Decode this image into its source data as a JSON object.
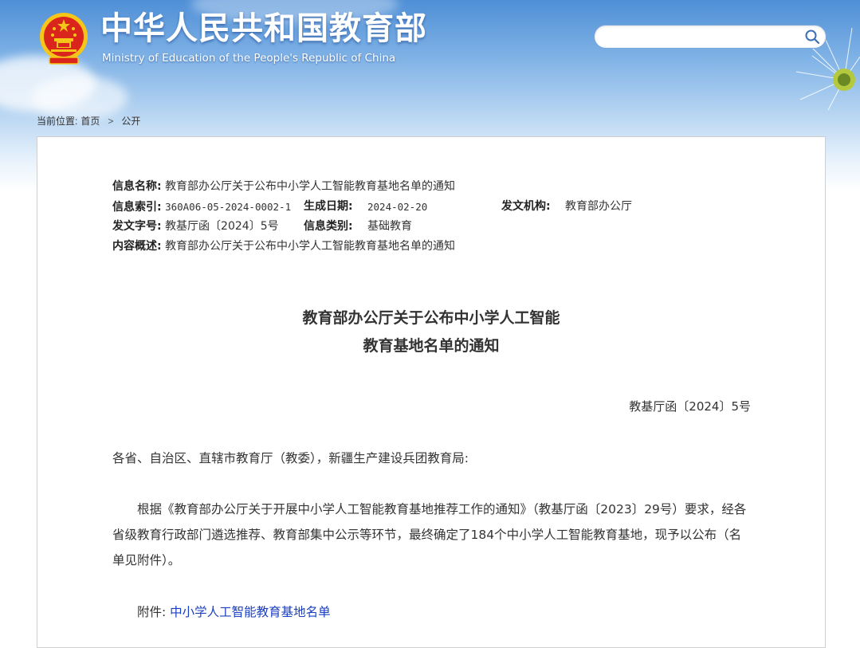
{
  "header": {
    "title_cn": "中华人民共和国教育部",
    "title_en": "Ministry of Education of the People's Republic of China",
    "search": {
      "placeholder": ""
    }
  },
  "breadcrumb": {
    "label": "当前位置:",
    "items": [
      "首页",
      "公开"
    ],
    "separator": ">"
  },
  "meta": {
    "name_label": "信息名称:",
    "name_value": "教育部办公厅关于公布中小学人工智能教育基地名单的通知",
    "index_label": "信息索引:",
    "index_value": "360A06-05-2024-0002-1",
    "date_label": "生成日期:",
    "date_value": "2024-02-20",
    "org_label": "发文机构:",
    "org_value": "教育部办公厅",
    "docno_label": "发文字号:",
    "docno_value": "教基厅函〔2024〕5号",
    "category_label": "信息类别:",
    "category_value": "基础教育",
    "summary_label": "内容概述:",
    "summary_value": "教育部办公厅关于公布中小学人工智能教育基地名单的通知"
  },
  "doc": {
    "title_line1": "教育部办公厅关于公布中小学人工智能",
    "title_line2": "教育基地名单的通知",
    "doc_number": "教基厅函〔2024〕5号",
    "addressee": "各省、自治区、直辖市教育厅（教委），新疆生产建设兵团教育局:",
    "paragraph": "根据《教育部办公厅关于开展中小学人工智能教育基地推荐工作的通知》（教基厅函〔2023〕29号）要求，经各省级教育行政部门遴选推荐、教育部集中公示等环节，最终确定了184个中小学人工智能教育基地，现予以公布（名单见附件）。",
    "attachment_label": "附件:",
    "attachment_link": "中小学人工智能教育基地名单"
  },
  "colors": {
    "sky_top": "#4f8fd6",
    "emblem_red": "#d9251c",
    "emblem_gold": "#f5c518",
    "link": "#1a3fbe"
  },
  "icons": [
    "national-emblem-icon",
    "search-icon",
    "dandelion-decoration"
  ]
}
